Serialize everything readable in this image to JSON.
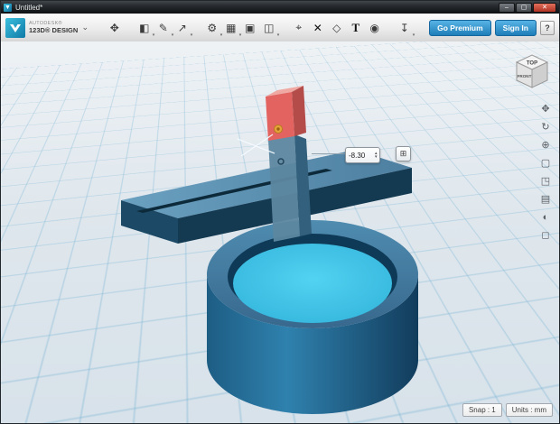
{
  "window": {
    "title": "Untitled*"
  },
  "icons": {
    "minimize": "–",
    "maximize": "▢",
    "close": "✕",
    "chevron_down": "⌄",
    "caret": "▾",
    "spinner_up": "▴",
    "spinner_down": "▾",
    "dimension_grid": "⊞",
    "help": "?"
  },
  "brand": {
    "line1": "AUTODESK®",
    "line2": "123D® DESIGN"
  },
  "toolbar": {
    "go_premium": "Go Premium",
    "sign_in": "Sign In",
    "items": [
      {
        "name": "transform-icon",
        "glyph": "✥"
      },
      {
        "name": "primitives-icon",
        "glyph": "◧"
      },
      {
        "name": "sketch-icon",
        "glyph": "✎"
      },
      {
        "name": "construct-icon",
        "glyph": "↗"
      },
      {
        "name": "modify-icon",
        "glyph": "⚙"
      },
      {
        "name": "pattern-icon",
        "glyph": "▦"
      },
      {
        "name": "grouping-icon",
        "glyph": "▣"
      },
      {
        "name": "combine-icon",
        "glyph": "◫"
      },
      {
        "name": "measure-icon",
        "glyph": "⌖"
      },
      {
        "name": "delete-icon",
        "glyph": "✕"
      },
      {
        "name": "primitive-box-icon",
        "glyph": "◇"
      },
      {
        "name": "text-icon",
        "glyph": "T"
      },
      {
        "name": "snap-icon",
        "glyph": "◉"
      },
      {
        "name": "export-icon",
        "glyph": "↧"
      }
    ]
  },
  "viewcube": {
    "top": "TOP",
    "front": "FRONT"
  },
  "right_toolbar": {
    "items": [
      {
        "name": "pan-icon",
        "glyph": "✥"
      },
      {
        "name": "orbit-icon",
        "glyph": "↻"
      },
      {
        "name": "zoom-icon",
        "glyph": "⊕"
      },
      {
        "name": "fit-view-icon",
        "glyph": "▢"
      },
      {
        "name": "zoom-window-icon",
        "glyph": "◳"
      },
      {
        "name": "view-settings-icon",
        "glyph": "▤"
      },
      {
        "name": "material-icon",
        "glyph": "◐"
      },
      {
        "name": "display-mode-icon",
        "glyph": "◻"
      }
    ]
  },
  "dimension": {
    "value": "-8.30"
  },
  "statusbar": {
    "snap": "Snap : 1",
    "units": "Units : mm"
  },
  "colors": {
    "accent_blue": "#2f81ae",
    "cavity_cyan": "#3ec3ea",
    "selection_red": "#e26360",
    "grid_line": "#7db6d6",
    "viewport_bg": "#e3e9ee",
    "button_blue": "#1e7eb8"
  }
}
